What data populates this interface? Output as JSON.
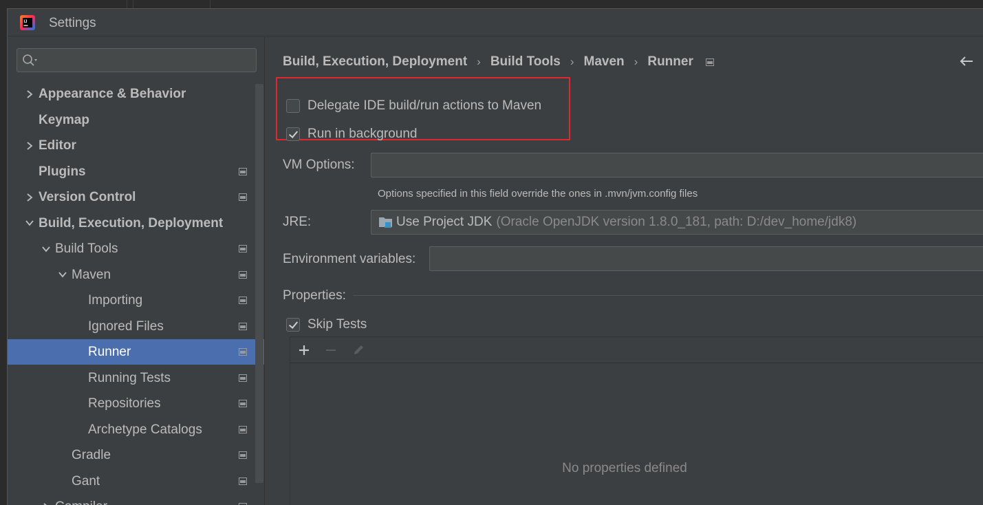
{
  "window": {
    "title": "Settings"
  },
  "search": {
    "placeholder": ""
  },
  "sidebar": {
    "items": [
      {
        "label": "Appearance & Behavior",
        "level": 0,
        "expandable": true,
        "expanded": false,
        "bold": true,
        "page_icon": false,
        "selected": false
      },
      {
        "label": "Keymap",
        "level": 0,
        "expandable": false,
        "expanded": false,
        "bold": true,
        "page_icon": false,
        "selected": false
      },
      {
        "label": "Editor",
        "level": 0,
        "expandable": true,
        "expanded": false,
        "bold": true,
        "page_icon": false,
        "selected": false
      },
      {
        "label": "Plugins",
        "level": 0,
        "expandable": false,
        "expanded": false,
        "bold": true,
        "page_icon": true,
        "selected": false
      },
      {
        "label": "Version Control",
        "level": 0,
        "expandable": true,
        "expanded": false,
        "bold": true,
        "page_icon": true,
        "selected": false
      },
      {
        "label": "Build, Execution, Deployment",
        "level": 0,
        "expandable": true,
        "expanded": true,
        "bold": true,
        "page_icon": false,
        "selected": false
      },
      {
        "label": "Build Tools",
        "level": 1,
        "expandable": true,
        "expanded": true,
        "bold": false,
        "page_icon": true,
        "selected": false
      },
      {
        "label": "Maven",
        "level": 2,
        "expandable": true,
        "expanded": true,
        "bold": false,
        "page_icon": true,
        "selected": false
      },
      {
        "label": "Importing",
        "level": 3,
        "expandable": false,
        "expanded": false,
        "bold": false,
        "page_icon": true,
        "selected": false
      },
      {
        "label": "Ignored Files",
        "level": 3,
        "expandable": false,
        "expanded": false,
        "bold": false,
        "page_icon": true,
        "selected": false
      },
      {
        "label": "Runner",
        "level": 3,
        "expandable": false,
        "expanded": false,
        "bold": false,
        "page_icon": true,
        "selected": true
      },
      {
        "label": "Running Tests",
        "level": 3,
        "expandable": false,
        "expanded": false,
        "bold": false,
        "page_icon": true,
        "selected": false
      },
      {
        "label": "Repositories",
        "level": 3,
        "expandable": false,
        "expanded": false,
        "bold": false,
        "page_icon": true,
        "selected": false
      },
      {
        "label": "Archetype Catalogs",
        "level": 3,
        "expandable": false,
        "expanded": false,
        "bold": false,
        "page_icon": true,
        "selected": false
      },
      {
        "label": "Gradle",
        "level": 2,
        "expandable": false,
        "expanded": false,
        "bold": false,
        "page_icon": true,
        "selected": false
      },
      {
        "label": "Gant",
        "level": 2,
        "expandable": false,
        "expanded": false,
        "bold": false,
        "page_icon": true,
        "selected": false
      },
      {
        "label": "Compiler",
        "level": 1,
        "expandable": true,
        "expanded": false,
        "bold": false,
        "page_icon": true,
        "selected": false
      }
    ]
  },
  "breadcrumb": [
    "Build, Execution, Deployment",
    "Build Tools",
    "Maven",
    "Runner"
  ],
  "runner": {
    "delegate_label": "Delegate IDE build/run actions to Maven",
    "delegate_checked": false,
    "background_label": "Run in background",
    "background_checked": true,
    "vm_options_label": "VM Options:",
    "vm_options_value": "",
    "vm_options_hint": "Options specified in this field override the ones in .mvn/jvm.config files",
    "jre_label": "JRE:",
    "jre_value": "Use Project JDK",
    "jre_detail": "(Oracle OpenJDK version 1.8.0_181, path: D:/dev_home/jdk8)",
    "env_label": "Environment variables:",
    "env_value": "",
    "properties_label": "Properties:",
    "skip_tests_label": "Skip Tests",
    "skip_tests_checked": true,
    "empty_properties": "No properties defined"
  },
  "colors": {
    "background": "#3c3f41",
    "selection": "#4b6eaf",
    "highlight_box": "#e0282e"
  },
  "icons": {
    "app": "intellij-idea-icon",
    "search": "search-icon",
    "back": "back-arrow-icon",
    "add": "plus-icon",
    "remove": "minus-icon",
    "edit": "pencil-icon",
    "jdk": "folder-cup-icon"
  }
}
